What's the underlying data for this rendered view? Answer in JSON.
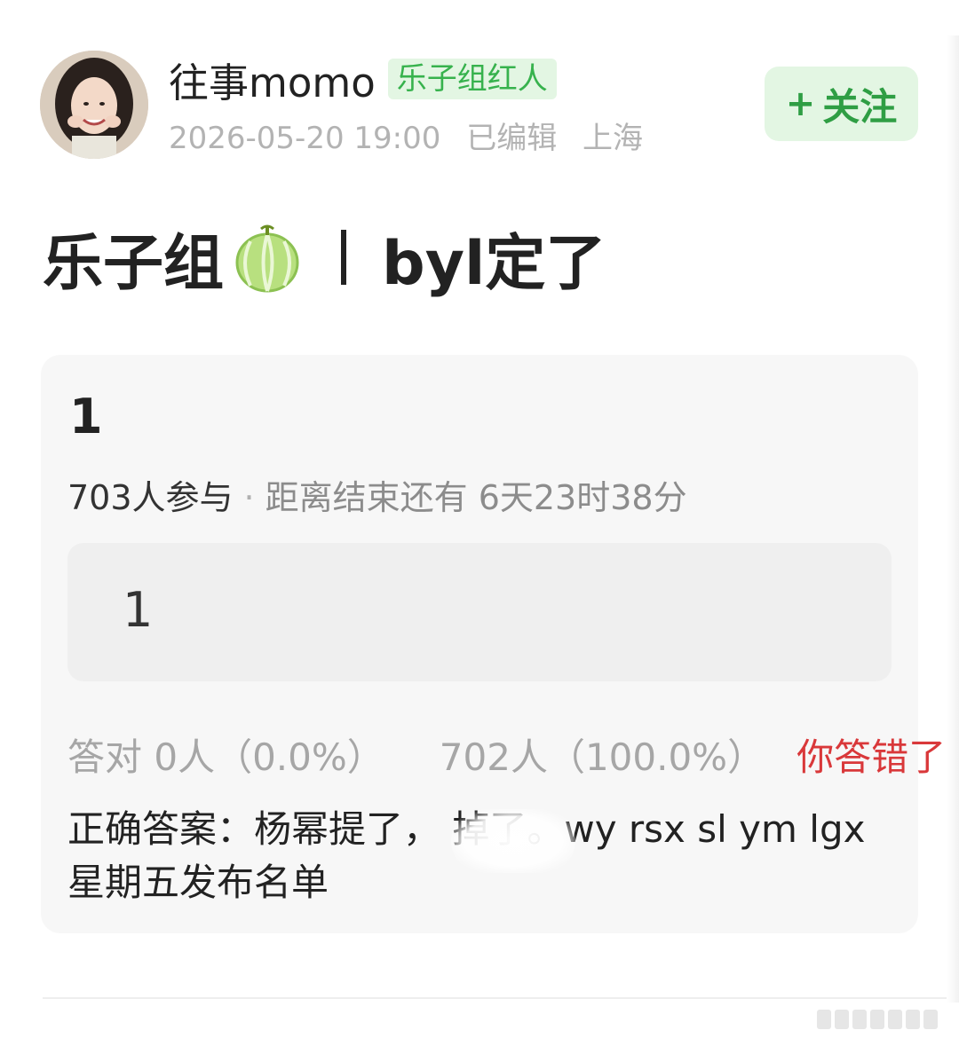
{
  "author": {
    "name": "往事momo",
    "badge": "乐子组红人",
    "timestamp": "2026-05-20 19:00",
    "edited_label": "已编辑",
    "location": "上海"
  },
  "follow_button": {
    "plus": "+",
    "label": "关注"
  },
  "post": {
    "title_prefix": "乐子组",
    "title_suffix": "byl定了",
    "title_icon": "melon-icon"
  },
  "quiz": {
    "question": "1",
    "participants": "703人参与",
    "separator": "·",
    "countdown": "距离结束还有 6天23时38分",
    "option": "1",
    "correct_stats": "答对  0人（0.0%）",
    "wrong_stats": "702人（100.0%）",
    "wrong_label": "你答错了",
    "answer": "正确答案：杨幂提了，    掉了。wy rsx sl ym lgx 星期五发布名单"
  },
  "colors": {
    "accent_green": "#37b24d",
    "badge_bg": "#e3f6e3",
    "wrong_red": "#d9383a",
    "card_bg": "#f7f7f7"
  }
}
